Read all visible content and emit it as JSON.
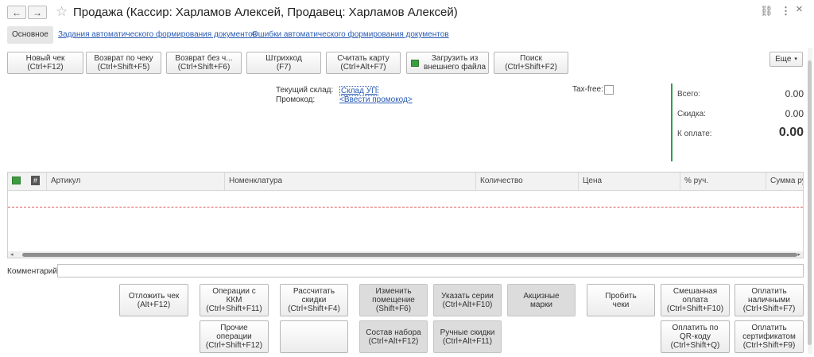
{
  "window": {
    "title": "Продажа (Кассир: Харламов Алексей, Продавец: Харламов Алексей)",
    "back_icon": "←",
    "forward_icon": "→",
    "star_icon": "☆",
    "link_icon": "⛓",
    "more_icon": "⋮",
    "close_icon": "×"
  },
  "tabs": {
    "main": "Основное",
    "links": [
      "Задания автоматического формирования документов",
      "Ошибки автоматического формирования документов"
    ]
  },
  "toolbar": {
    "buttons": [
      "Новый чек\n(Ctrl+F12)",
      "Возврат по чеку\n(Ctrl+Shift+F5)",
      "Возврат без ч...\n(Ctrl+Shift+F6)",
      "Штрихкод\n(F7)",
      "Считать карту\n(Ctrl+Alt+F7)",
      "Загрузить из\nвнешнего файла",
      "Поиск\n(Ctrl+Shift+F2)"
    ],
    "more": "Еще"
  },
  "info": {
    "warehouse_label": "Текущий склад:",
    "warehouse_value": "Склад УП",
    "promo_label": "Промокод:",
    "promo_value": "<Ввести промокод>",
    "taxfree_label": "Tax-free:"
  },
  "totals": {
    "total_label": "Всего:",
    "total_value": "0.00",
    "discount_label": "Скидка:",
    "discount_value": "0.00",
    "pay_label": "К оплате:",
    "pay_value": "0.00",
    "accent_color": "#2e9e47"
  },
  "table": {
    "columns": [
      "Артикул",
      "Номенклатура",
      "Количество",
      "Цена",
      "% руч.",
      "Сумма ру"
    ]
  },
  "comment": {
    "label": "Комментарий:",
    "value": ""
  },
  "actions": {
    "postpone": "Отложить чек\n(Alt+F12)",
    "kkm_ops": "Операции с\nККМ\n(Ctrl+Shift+F11)",
    "calc_discounts": "Рассчитать\nскидки\n(Ctrl+Shift+F4)",
    "change_room": "Изменить\nпомещение\n(Shift+F6)",
    "set_series": "Указать серии\n(Ctrl+Alt+F10)",
    "excise": "Акцизные\nмарки",
    "punch": "Пробить\nчеки",
    "mixed_pay": "Смешанная\nоплата\n(Ctrl+Shift+F10)",
    "pay_cash": "Оплатить\nналичными\n(Ctrl+Shift+F7)",
    "other_ops": "Прочие\nоперации\n(Ctrl+Shift+F12)",
    "blank": "",
    "kit": "Состав набора\n(Ctrl+Alt+F12)",
    "manual_discounts": "Ручные скидки\n(Ctrl+Alt+F11)",
    "pay_qr": "Оплатить по\nQR-коду\n(Ctrl+Shift+Q)",
    "pay_cert": "Оплатить\nсертификатом\n(Ctrl+Shift+F9)"
  }
}
